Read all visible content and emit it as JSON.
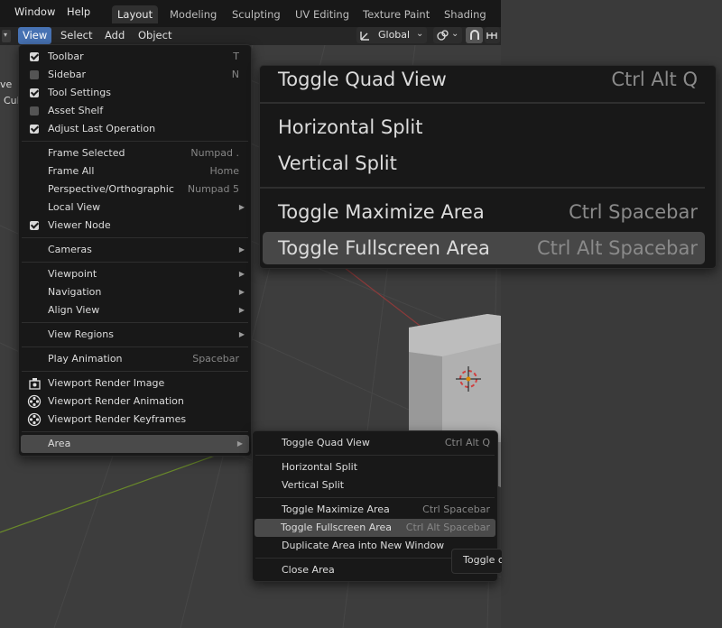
{
  "topbar": {
    "menus": [
      "Window",
      "Help"
    ],
    "workspace_tabs": [
      "Layout",
      "Modeling",
      "Sculpting",
      "UV Editing",
      "Texture Paint",
      "Shading"
    ]
  },
  "header": {
    "menus": [
      "View",
      "Select",
      "Add",
      "Object"
    ],
    "transform_orientation": "Global"
  },
  "viewport": {
    "left_fragments": [
      "ve",
      "Cul"
    ]
  },
  "view_menu": {
    "items": [
      {
        "label": "Toolbar",
        "shortcut": "T",
        "checked": true
      },
      {
        "label": "Sidebar",
        "shortcut": "N",
        "checked": false
      },
      {
        "label": "Tool Settings",
        "shortcut": "",
        "checked": true
      },
      {
        "label": "Asset Shelf",
        "shortcut": "",
        "checked": false
      },
      {
        "label": "Adjust Last Operation",
        "shortcut": "",
        "checked": true
      },
      {
        "label": "Frame Selected",
        "shortcut": "Numpad ."
      },
      {
        "label": "Frame All",
        "shortcut": "Home"
      },
      {
        "label": "Perspective/Orthographic",
        "shortcut": "Numpad 5"
      },
      {
        "label": "Local View",
        "submenu": true
      },
      {
        "label": "Viewer Node",
        "checked": true
      },
      {
        "label": "Cameras",
        "submenu": true
      },
      {
        "label": "Viewpoint",
        "submenu": true
      },
      {
        "label": "Navigation",
        "submenu": true
      },
      {
        "label": "Align View",
        "submenu": true
      },
      {
        "label": "View Regions",
        "submenu": true
      },
      {
        "label": "Play Animation",
        "shortcut": "Spacebar"
      },
      {
        "label": "Viewport Render Image",
        "icon": "render-image-icon"
      },
      {
        "label": "Viewport Render Animation",
        "icon": "render-animation-icon"
      },
      {
        "label": "Viewport Render Keyframes",
        "icon": "render-keyframes-icon"
      },
      {
        "label": "Area",
        "submenu": true,
        "highlighted": true
      }
    ]
  },
  "area_menu": {
    "items": [
      {
        "label": "Toggle Quad View",
        "shortcut": "Ctrl Alt Q"
      },
      {
        "label": "Horizontal Split",
        "shortcut": ""
      },
      {
        "label": "Vertical Split",
        "shortcut": ""
      },
      {
        "label": "Toggle Maximize Area",
        "shortcut": "Ctrl Spacebar"
      },
      {
        "label": "Toggle Fullscreen Area",
        "shortcut": "Ctrl Alt Spacebar",
        "highlighted": true
      },
      {
        "label": "Duplicate Area into New Window",
        "shortcut": ""
      },
      {
        "label": "Close Area",
        "shortcut": ""
      }
    ]
  },
  "tooltip": {
    "text": "Toggle c"
  },
  "colors": {
    "accent": "#4772b3",
    "menu_bg": "#181818",
    "highlight": "#4a4a4a",
    "viewport": "#3d3d3d"
  }
}
